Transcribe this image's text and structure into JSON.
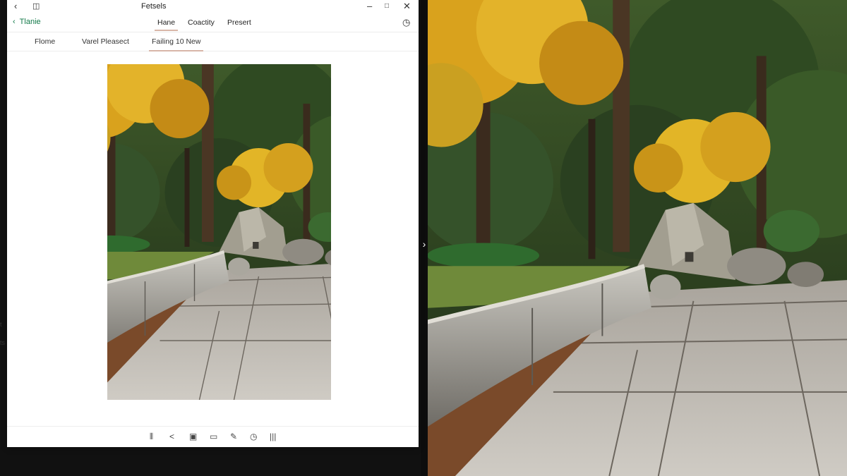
{
  "window": {
    "title": "Fetsels",
    "back_label": "Tlanie",
    "nav_tabs": [
      {
        "label": "Hane",
        "active": true
      },
      {
        "label": "Coactity",
        "active": false
      },
      {
        "label": "Presert",
        "active": false
      }
    ],
    "sub_tabs": [
      {
        "label": "Flome",
        "active": false
      },
      {
        "label": "Varel Pleasect",
        "active": false
      },
      {
        "label": "Failing 10 New",
        "active": true
      }
    ]
  },
  "left_margin": {
    "marks": [
      "t",
      "ts"
    ]
  },
  "icons": {
    "titlebar": [
      "back-arrow-icon",
      "panel-icon",
      "minimize-icon",
      "maximize-icon",
      "close-icon"
    ],
    "nav_right": "clock-icon",
    "toolbar": [
      "columns-icon",
      "share-icon",
      "frame-icon",
      "copy-icon",
      "edit-icon",
      "history-icon",
      "menu-icon"
    ],
    "divider": "chevron-right-icon"
  },
  "colors": {
    "accent_green": "#137a4a",
    "tab_underline": "#d8b6a8",
    "window_bg": "#ffffff"
  }
}
